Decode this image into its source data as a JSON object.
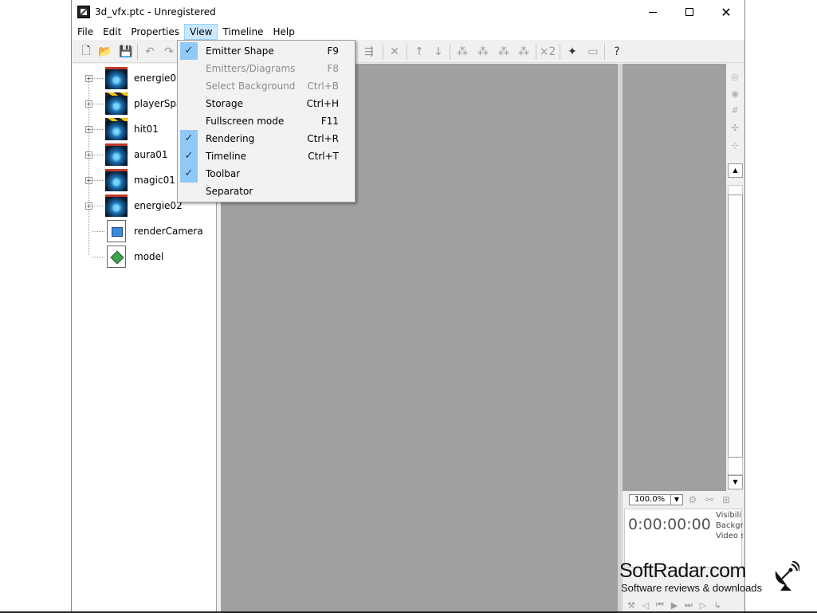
{
  "window": {
    "title": "3d_vfx.ptc - Unregistered",
    "controls": {
      "minimize": "—",
      "maximize": "☐",
      "close": "✕"
    }
  },
  "menubar": {
    "items": [
      "File",
      "Edit",
      "Properties",
      "View",
      "Timeline",
      "Help"
    ],
    "active": "View"
  },
  "view_menu": {
    "items": [
      {
        "label": "Emitter Shape",
        "shortcut": "F9",
        "checked": true,
        "enabled": true
      },
      {
        "label": "Emitters/Diagrams",
        "shortcut": "F8",
        "checked": false,
        "enabled": false
      },
      {
        "label": "Select Background",
        "shortcut": "Ctrl+B",
        "checked": false,
        "enabled": false
      },
      {
        "label": "Storage",
        "shortcut": "Ctrl+H",
        "checked": false,
        "enabled": true
      },
      {
        "label": "Fullscreen mode",
        "shortcut": "F11",
        "checked": false,
        "enabled": true
      },
      {
        "label": "Rendering",
        "shortcut": "Ctrl+R",
        "checked": true,
        "enabled": true
      },
      {
        "label": "Timeline",
        "shortcut": "Ctrl+T",
        "checked": true,
        "enabled": true
      },
      {
        "label": "Toolbar",
        "shortcut": "",
        "checked": true,
        "enabled": true
      },
      {
        "label": "Separator",
        "shortcut": "",
        "checked": false,
        "enabled": true
      }
    ]
  },
  "tree": {
    "nodes": [
      {
        "label": "energie01",
        "kind": "emitter",
        "expandable": true
      },
      {
        "label": "playerSpav",
        "kind": "emitter",
        "expandable": true
      },
      {
        "label": "hit01",
        "kind": "emitter",
        "expandable": true
      },
      {
        "label": "aura01",
        "kind": "emitter",
        "expandable": true
      },
      {
        "label": "magic01",
        "kind": "emitter",
        "expandable": true
      },
      {
        "label": "energie02",
        "kind": "emitter",
        "expandable": true
      },
      {
        "label": "renderCamera",
        "kind": "camera",
        "expandable": false
      },
      {
        "label": "model",
        "kind": "model",
        "expandable": false
      }
    ]
  },
  "timeline": {
    "zoom": "100.0%",
    "time": "0:00:00:00",
    "options": [
      "Visibili",
      "Backgr",
      "Video s"
    ]
  },
  "watermark": {
    "title": "SoftRadar.com",
    "subtitle": "Software reviews & downloads"
  },
  "colors": {
    "viewport_bg": "#a0a0a0",
    "menu_check_bg": "#90c8f6",
    "active_menu_bg": "#cce8ff"
  }
}
